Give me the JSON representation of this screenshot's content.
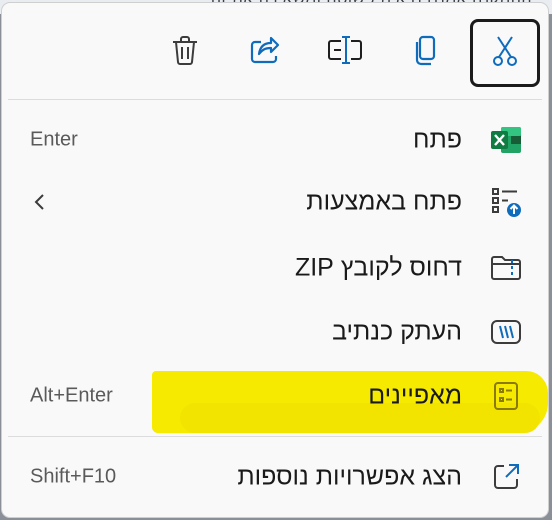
{
  "background_text": "ההתקנה אמנם נראית פשוטה ומשאירה את זה",
  "toolbar": {
    "buttons": [
      {
        "name": "cut",
        "icon": "scissors-icon",
        "selected": true
      },
      {
        "name": "copy",
        "icon": "copy-icon"
      },
      {
        "name": "rename",
        "icon": "rename-icon"
      },
      {
        "name": "share",
        "icon": "share-icon"
      },
      {
        "name": "delete",
        "icon": "trash-icon"
      }
    ]
  },
  "menu": {
    "open": {
      "label": "פתח",
      "shortcut": "Enter",
      "icon": "excel-icon"
    },
    "open_with": {
      "label": "פתח באמצעות",
      "icon": "open-with-icon",
      "has_submenu": true
    },
    "compress": {
      "label": "דחוס לקובץ ZIP",
      "icon": "zip-folder-icon"
    },
    "copy_path": {
      "label": "העתק כנתיב",
      "icon": "copy-path-icon"
    },
    "properties": {
      "label": "מאפיינים",
      "shortcut": "Alt+Enter",
      "icon": "properties-icon",
      "highlighted": true
    },
    "more_options": {
      "label": "הצג אפשרויות נוספות",
      "shortcut": "Shift+F10",
      "icon": "more-options-icon"
    }
  },
  "colors": {
    "accent": "#0f6cbd",
    "excel_green": "#107c41",
    "highlight": "#f6ea00",
    "properties_icon": "#9b8a00"
  }
}
